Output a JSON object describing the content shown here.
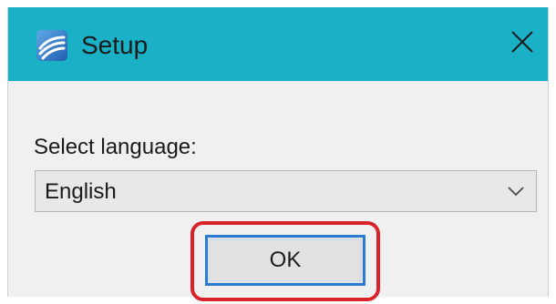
{
  "window": {
    "title": "Setup",
    "title_icon": "app-logo-icon",
    "close_icon": "close-icon",
    "titlebar_color": "#1ab0c5"
  },
  "form": {
    "label": "Select language:",
    "language_select": {
      "selected": "English",
      "icon": "chevron-down-icon"
    },
    "ok_label": "OK",
    "highlight_color": "#d9232a"
  }
}
